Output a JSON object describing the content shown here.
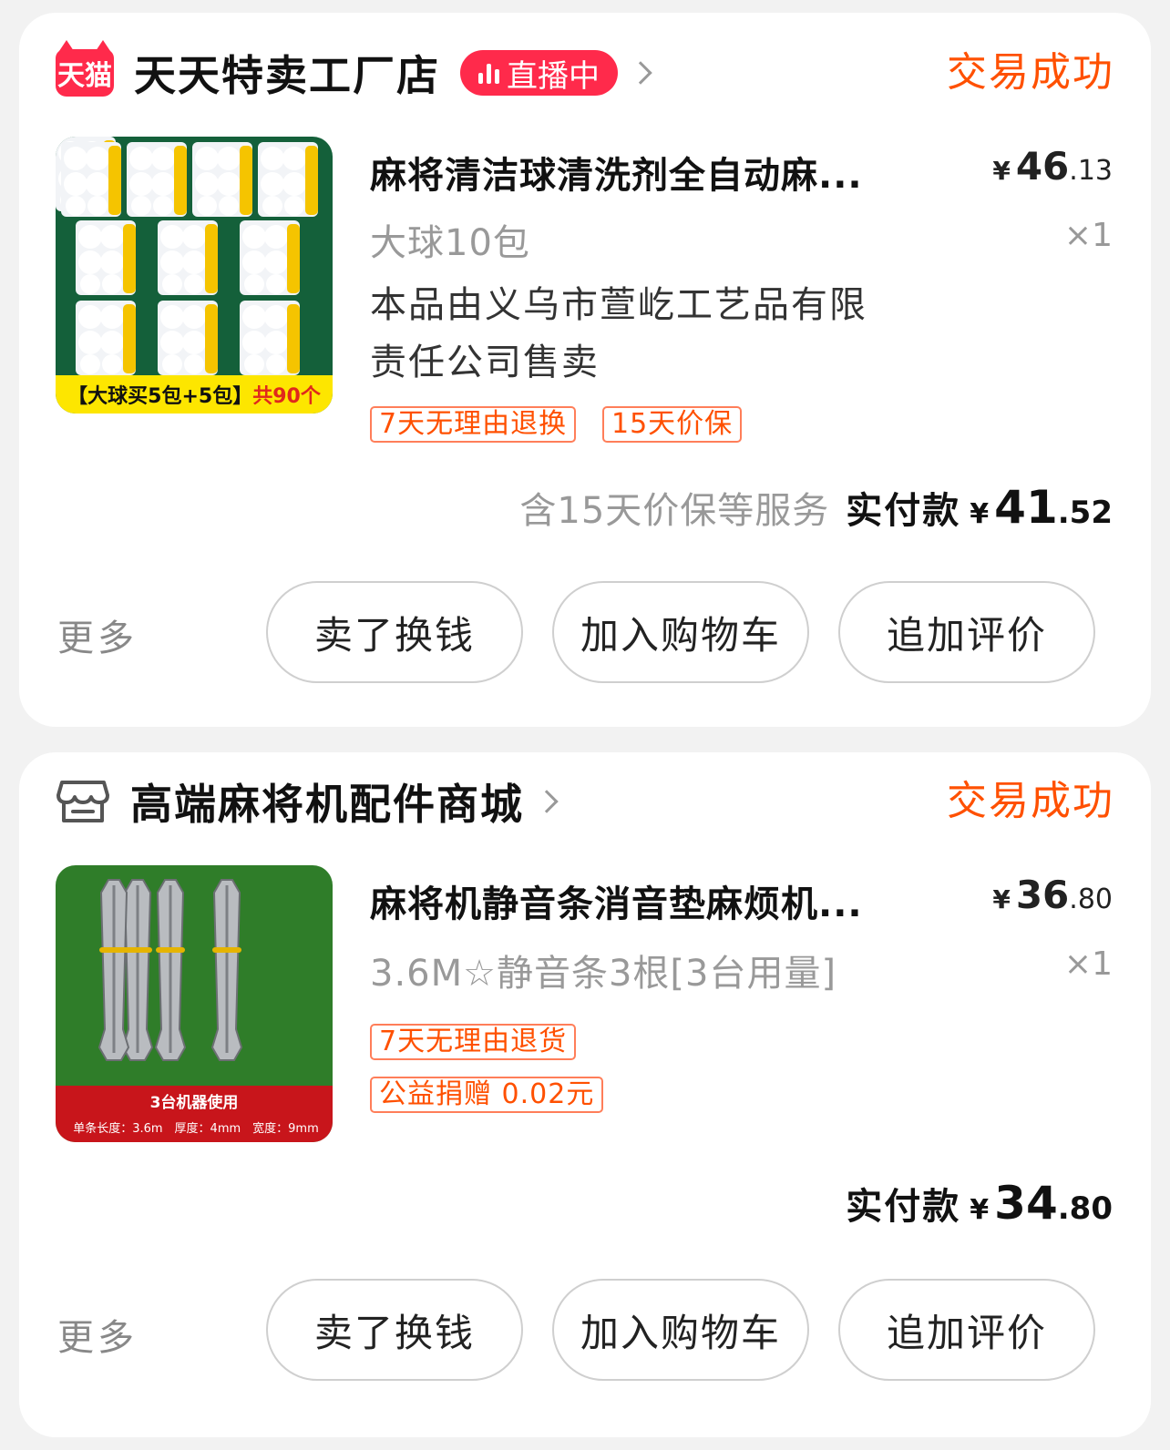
{
  "orders": [
    {
      "shop": {
        "logo_text": "天猫",
        "name": "天天特卖工厂店",
        "live_label": "直播中",
        "icon": "tmall-logo"
      },
      "status": "交易成功",
      "item": {
        "title": "麻将清洁球清洗剂全自动麻...",
        "price_int": "46",
        "price_dec": ".13",
        "currency": "¥",
        "spec": "大球10包",
        "qty": "×1",
        "seller_line1": "本品由义乌市萱屹工艺品有限",
        "seller_line2": "责任公司售卖",
        "tags": [
          "7天无理由退换",
          "15天价保"
        ],
        "image_caption_a": "【大球买5包+5包】",
        "image_caption_b": "共90个"
      },
      "service_note": "含15天价保等服务",
      "paid_label": "实付款",
      "paid_int": "41",
      "paid_dec": ".52",
      "more_label": "更多",
      "buttons": [
        "卖了换钱",
        "加入购物车",
        "追加评价"
      ]
    },
    {
      "shop": {
        "name": "高端麻将机配件商城",
        "icon": "store-icon"
      },
      "status": "交易成功",
      "item": {
        "title": "麻将机静音条消音垫麻烦机...",
        "price_int": "36",
        "price_dec": ".80",
        "currency": "¥",
        "spec": "3.6M☆静音条3根[3台用量]",
        "qty": "×1",
        "tags": [
          "7天无理由退货",
          "公益捐赠 0.02元"
        ],
        "image_caption": "3台机器使用",
        "image_spec": "单条长度：3.6m　厚度：4mm　宽度：9mm"
      },
      "paid_label": "实付款",
      "paid_int": "34",
      "paid_dec": ".80",
      "more_label": "更多",
      "buttons": [
        "卖了换钱",
        "加入购物车",
        "追加评价"
      ]
    }
  ],
  "colors": {
    "accent": "#ff5000",
    "tmall_red": "#ff2a4b"
  }
}
